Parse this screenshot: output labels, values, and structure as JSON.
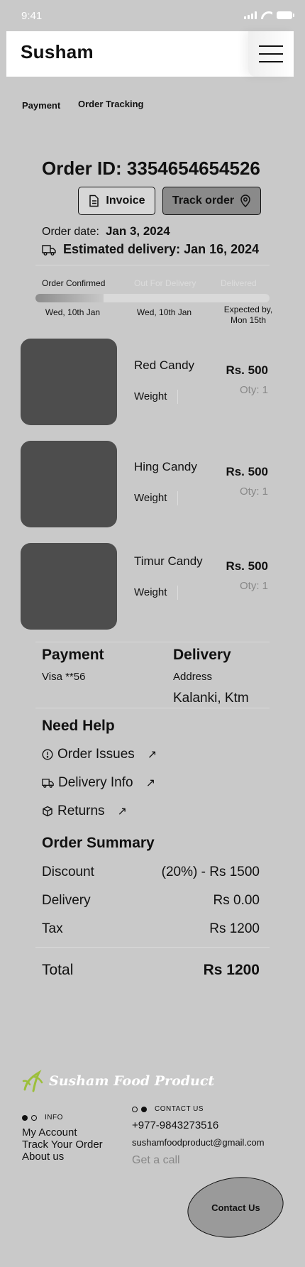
{
  "status_bar": {
    "time": "9:41"
  },
  "header": {
    "brand": "Susham"
  },
  "tabs": [
    {
      "label": "Payment"
    },
    {
      "label": "Order Tracking"
    }
  ],
  "order": {
    "id_label": "Order ID: 3354654654526",
    "invoice_label": "Invoice",
    "track_label": "Track order",
    "date_label": "Order date:",
    "date_value": "Jan 3, 2024",
    "estimated": "Estimated delivery: Jan 16, 2024"
  },
  "tracking": {
    "progress_fraction": 0.29,
    "steps": [
      {
        "label": "Order Confirmed"
      },
      {
        "label": "Out For Delivery"
      },
      {
        "label": "Delivered"
      }
    ],
    "dates": [
      "Wed, 10th Jan",
      "Wed, 10th Jan",
      "Expected by,",
      "Mon 15th"
    ]
  },
  "products": [
    {
      "name": "Red Candy",
      "weight_label": "Weight",
      "price": "Rs. 500",
      "qty": "Oty: 1"
    },
    {
      "name": "Hing Candy",
      "weight_label": "Weight",
      "price": "Rs. 500",
      "qty": "Oty: 1"
    },
    {
      "name": "Timur Candy",
      "weight_label": "Weight",
      "price": "Rs. 500",
      "qty": "Oty: 1"
    }
  ],
  "payment": {
    "title": "Payment",
    "method": "Visa **56"
  },
  "delivery": {
    "title": "Delivery",
    "address_label": "Address",
    "address": "Kalanki, Ktm"
  },
  "help": {
    "title": "Need Help",
    "items": [
      {
        "label": "Order Issues"
      },
      {
        "label": "Delivery Info"
      },
      {
        "label": "Returns"
      }
    ]
  },
  "summary": {
    "title": "Order Summary",
    "rows": [
      {
        "label": "Discount",
        "value": "(20%) - Rs 1500"
      },
      {
        "label": "Delivery",
        "value": "Rs 0.00"
      },
      {
        "label": "Tax",
        "value": "Rs 1200"
      }
    ],
    "total_label": "Total",
    "total_value": "Rs 1200"
  },
  "footer": {
    "logo_text": "Susham Food Product",
    "info_label": "INFO",
    "info_links": [
      "My Account",
      "Track Your Order",
      "About us"
    ],
    "contact_label": "CONTACT US",
    "phone": "+977-9843273516",
    "email": "sushamfoodproduct@gmail.com",
    "call": "Get a call",
    "contact_button": "Contact Us"
  },
  "colors": {
    "accent": "#4d4d4d",
    "background": "#c9c9c9",
    "logo_green": "#9cbf3b"
  }
}
